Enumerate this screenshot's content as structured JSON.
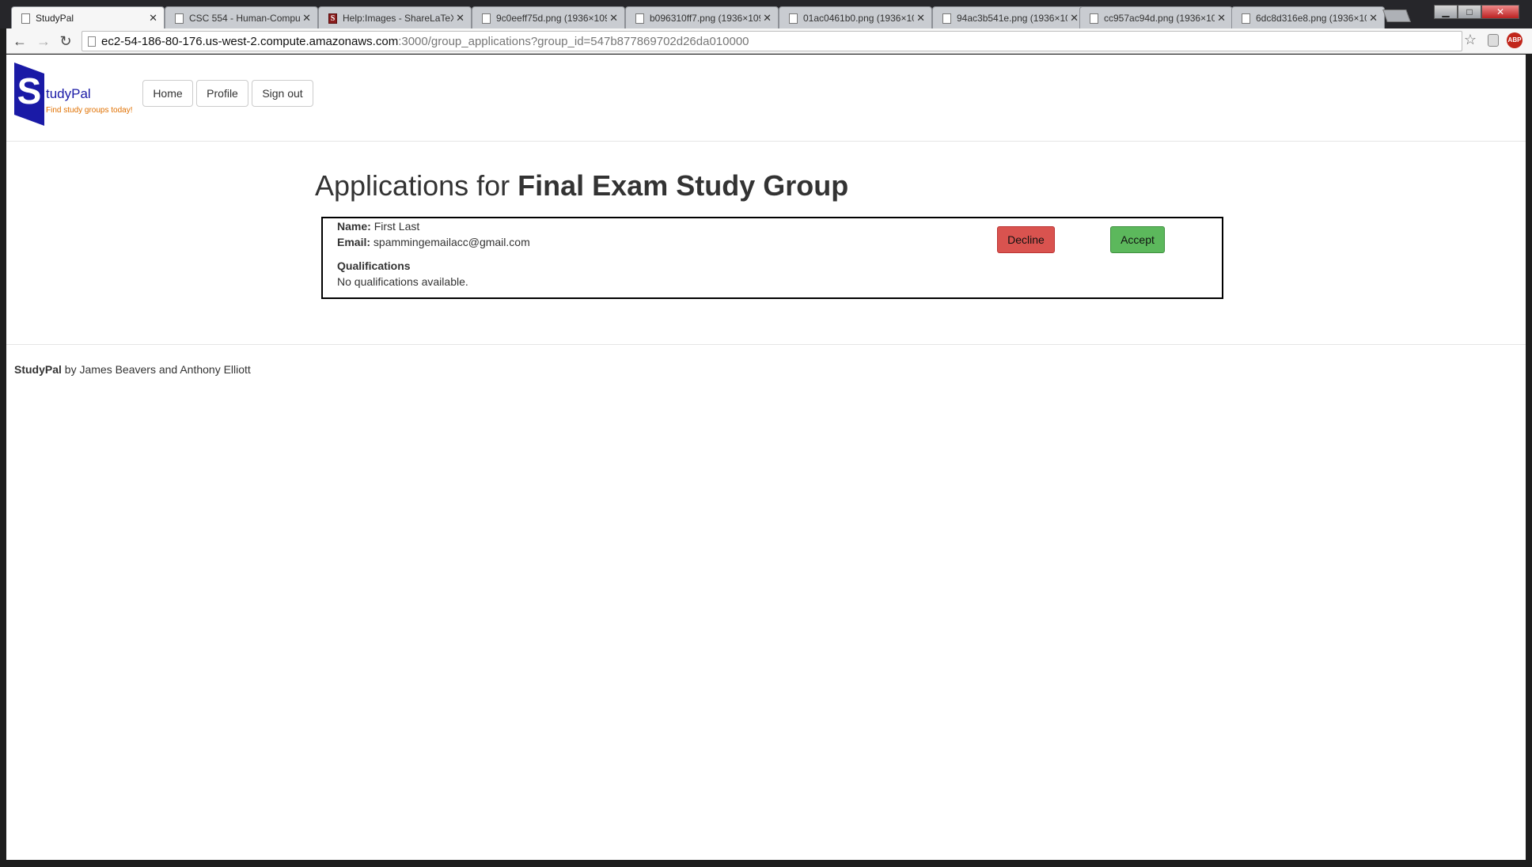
{
  "browser": {
    "tabs": [
      {
        "title": "StudyPal",
        "icon": "page-icon",
        "active": true
      },
      {
        "title": "CSC 554 - Human-Compu",
        "icon": "page-icon",
        "active": false
      },
      {
        "title": "Help:Images - ShareLaTeX",
        "icon": "sharelatex-icon",
        "active": false
      },
      {
        "title": "9c0eeff75d.png (1936×109",
        "icon": "page-icon",
        "active": false
      },
      {
        "title": "b096310ff7.png (1936×109",
        "icon": "page-icon",
        "active": false
      },
      {
        "title": "01ac0461b0.png (1936×10",
        "icon": "page-icon",
        "active": false
      },
      {
        "title": "94ac3b541e.png (1936×10",
        "icon": "page-icon",
        "active": false
      },
      {
        "title": "cc957ac94d.png (1936×10",
        "icon": "page-icon",
        "active": false
      },
      {
        "title": "6dc8d316e8.png (1936×10",
        "icon": "page-icon",
        "active": false
      }
    ],
    "url_host": "ec2-54-186-80-176.us-west-2.compute.amazonaws.com",
    "url_path": ":3000/group_applications?group_id=547b877869702d26da010000",
    "abp_label": "ABP"
  },
  "header": {
    "logo_letter": "S",
    "brand": "tudyPal",
    "tagline": "Find study groups today!",
    "nav": [
      "Home",
      "Profile",
      "Sign out"
    ]
  },
  "main": {
    "title_prefix": "Applications for ",
    "group_name": "Final Exam Study Group",
    "application": {
      "name_label": "Name:",
      "name_value": "First Last",
      "email_label": "Email:",
      "email_value": "spammingemailacc@gmail.com",
      "qualifications_label": "Qualifications",
      "qualifications_value": "No qualifications available.",
      "decline_label": "Decline",
      "accept_label": "Accept"
    }
  },
  "footer": {
    "brand": "StudyPal",
    "credit": " by James Beavers and Anthony Elliott"
  },
  "colors": {
    "logo_blue": "#1a1aa6",
    "tagline_orange": "#e07000",
    "decline_red": "#d9534f",
    "accept_green": "#5cb85c"
  }
}
